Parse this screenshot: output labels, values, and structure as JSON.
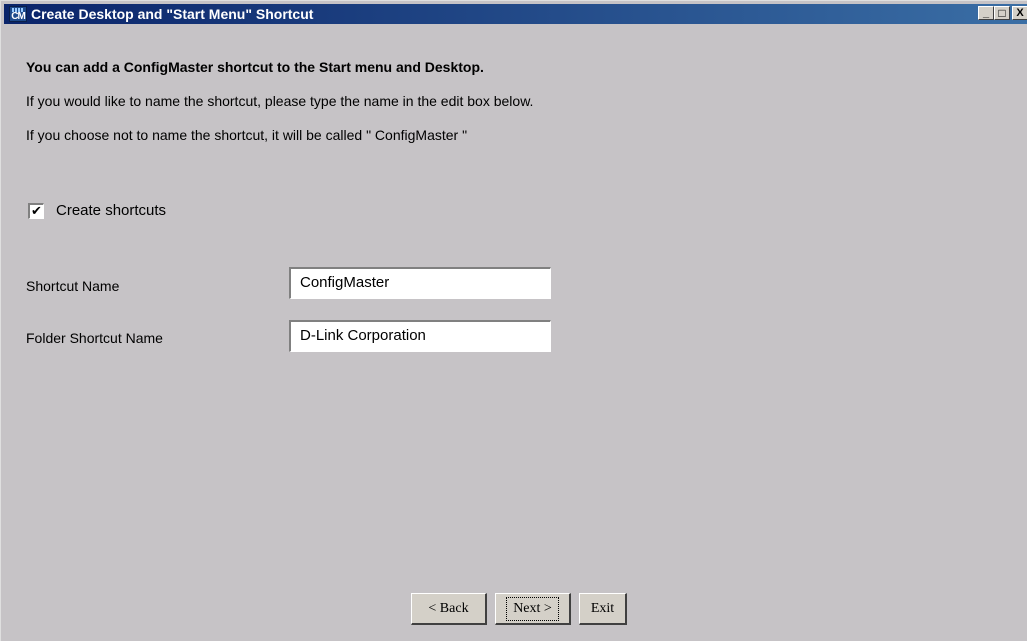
{
  "window": {
    "title": "Create Desktop and \"Start Menu\" Shortcut",
    "minimize": "_",
    "maximize": "□",
    "close": "X"
  },
  "content": {
    "heading": "You can add a ConfigMaster shortcut to the Start menu and Desktop.",
    "line1": "If you would like to name the shortcut, please type the name in the edit box below.",
    "line2": "If you choose not to name the shortcut, it will be called \" ConfigMaster \"",
    "checkbox_label": "Create shortcuts",
    "checkbox_checked": true,
    "shortcut_name_label": "Shortcut Name",
    "shortcut_name_value": "ConfigMaster",
    "folder_name_label": "Folder Shortcut Name",
    "folder_name_value": "D-Link Corporation"
  },
  "buttons": {
    "back": "< Back",
    "next": "Next >",
    "exit": "Exit"
  }
}
